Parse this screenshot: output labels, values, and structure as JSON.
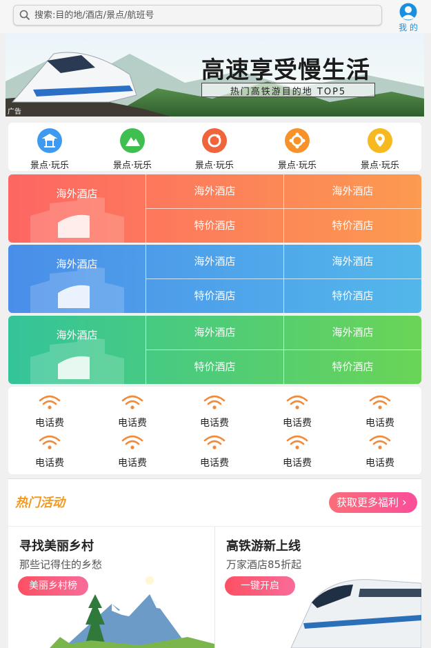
{
  "search": {
    "placeholder": "搜索:目的地/酒店/景点/航班号"
  },
  "me": {
    "label": "我 的"
  },
  "banner": {
    "headline": "高速享受慢生活",
    "subline": "热门高铁游目的地 TOP5",
    "ad_tag": "广告"
  },
  "categories": [
    {
      "label": "景点·玩乐",
      "icon": "temple-icon",
      "color": "#3d9af0"
    },
    {
      "label": "景点·玩乐",
      "icon": "mountain-icon",
      "color": "#3fbf50"
    },
    {
      "label": "景点·玩乐",
      "icon": "refresh-icon",
      "color": "#f0643c"
    },
    {
      "label": "景点·玩乐",
      "icon": "flower-icon",
      "color": "#f7922a"
    },
    {
      "label": "景点·玩乐",
      "icon": "location-pin-icon",
      "color": "#f6b91f"
    }
  ],
  "hotel_grids": [
    {
      "big": "海外酒店",
      "top": [
        "海外酒店",
        "海外酒店"
      ],
      "bottom": [
        "特价酒店",
        "特价酒店"
      ],
      "colors": [
        "#fd6663",
        "#fc9a50"
      ]
    },
    {
      "big": "海外酒店",
      "top": [
        "海外酒店",
        "海外酒店"
      ],
      "bottom": [
        "特价酒店",
        "特价酒店"
      ],
      "colors": [
        "#4a8ee9",
        "#53b7ea"
      ]
    },
    {
      "big": "海外酒店",
      "top": [
        "海外酒店",
        "海外酒店"
      ],
      "bottom": [
        "特价酒店",
        "特价酒店"
      ],
      "colors": [
        "#34c49a",
        "#6ad456"
      ]
    }
  ],
  "phone_items": [
    "电话费",
    "电话费",
    "电话费",
    "电话费",
    "电话费",
    "电话费",
    "电话费",
    "电话费",
    "电话费",
    "电话费"
  ],
  "hot": {
    "title": "热门活动",
    "more": "获取更多福利"
  },
  "cards": [
    {
      "title": "寻找美丽乡村",
      "subtitle": "那些记得住的乡愁",
      "button": "美丽乡村榜"
    },
    {
      "title": "高铁游新上线",
      "subtitle": "万家酒店85折起",
      "button": "一键开启"
    }
  ]
}
